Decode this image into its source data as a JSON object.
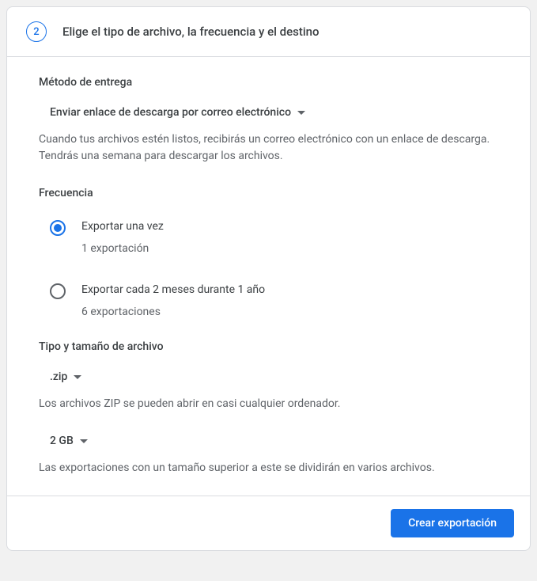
{
  "step": {
    "number": "2",
    "title": "Elige el tipo de archivo, la frecuencia y el destino"
  },
  "delivery": {
    "section_title": "Método de entrega",
    "selected": "Enviar enlace de descarga por correo electrónico",
    "help": "Cuando tus archivos estén listos, recibirás un correo electrónico con un enlace de descarga. Tendrás una semana para descargar los archivos."
  },
  "frequency": {
    "section_title": "Frecuencia",
    "options": [
      {
        "label": "Exportar una vez",
        "sublabel": "1 exportación",
        "checked": true
      },
      {
        "label": "Exportar cada 2 meses durante 1 año",
        "sublabel": "6 exportaciones",
        "checked": false
      }
    ]
  },
  "filetype": {
    "section_title": "Tipo y tamaño de archivo",
    "type_selected": ".zip",
    "type_help": "Los archivos ZIP se pueden abrir en casi cualquier ordenador.",
    "size_selected": "2 GB",
    "size_help": "Las exportaciones con un tamaño superior a este se dividirán en varios archivos."
  },
  "footer": {
    "create_button": "Crear exportación"
  }
}
